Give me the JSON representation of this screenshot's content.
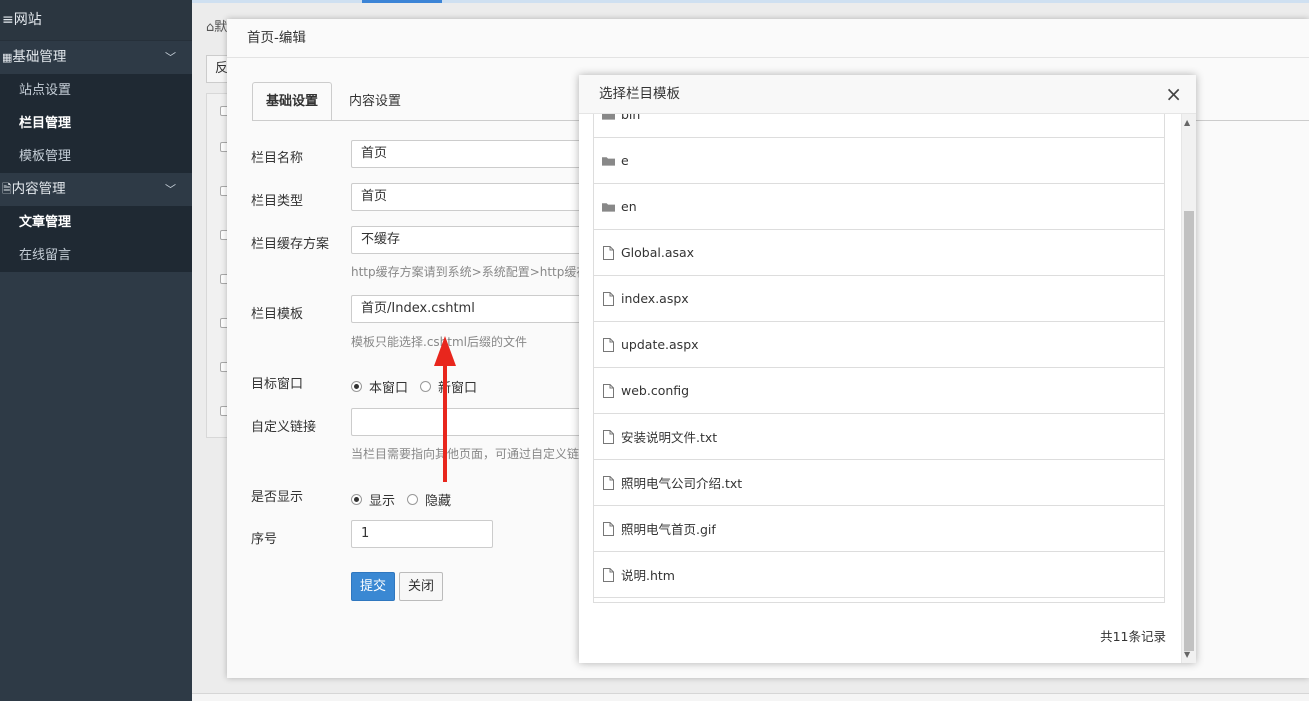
{
  "sidebar": {
    "brand": "≡网站",
    "groups": [
      {
        "label": "基础管理",
        "icon": "grid-icon",
        "items": [
          "站点设置",
          "栏目管理",
          "模板管理"
        ]
      },
      {
        "label": "内容管理",
        "icon": "document-icon",
        "items": [
          "文章管理",
          "在线留言"
        ]
      }
    ]
  },
  "background": {
    "breadcrumb_prefix": "默",
    "button_text": "反"
  },
  "edit_modal": {
    "title": "首页-编辑",
    "tabs": [
      "基础设置",
      "内容设置"
    ],
    "fields": {
      "name_label": "栏目名称",
      "name_value": "首页",
      "type_label": "栏目类型",
      "type_value": "首页",
      "cache_label": "栏目缓存方案",
      "cache_value": "不缓存",
      "cache_help": "http缓存方案请到系统>系统配置>http缓存",
      "template_label": "栏目模板",
      "template_value": "首页/Index.cshtml",
      "template_help": "模板只能选择.cshtml后缀的文件",
      "target_label": "目标窗口",
      "target_opt1": "本窗口",
      "target_opt2": "新窗口",
      "link_label": "自定义链接",
      "link_value": "",
      "link_help": "当栏目需要指向其他页面，可通过自定义链",
      "show_label": "是否显示",
      "show_opt1": "显示",
      "show_opt2": "隐藏",
      "order_label": "序号",
      "order_value": "1"
    },
    "submit_label": "提交",
    "close_label": "关闭"
  },
  "picker": {
    "title": "选择栏目模板",
    "close": "×",
    "files": [
      {
        "name": "bin",
        "type": "folder"
      },
      {
        "name": "e",
        "type": "folder"
      },
      {
        "name": "en",
        "type": "folder"
      },
      {
        "name": "Global.asax",
        "type": "file"
      },
      {
        "name": "index.aspx",
        "type": "file"
      },
      {
        "name": "update.aspx",
        "type": "file"
      },
      {
        "name": "web.config",
        "type": "file"
      },
      {
        "name": "安装说明文件.txt",
        "type": "file"
      },
      {
        "name": "照明电气公司介绍.txt",
        "type": "file"
      },
      {
        "name": "照明电气首页.gif",
        "type": "file"
      },
      {
        "name": "说明.htm",
        "type": "file"
      }
    ],
    "count_text": "共11条记录"
  }
}
